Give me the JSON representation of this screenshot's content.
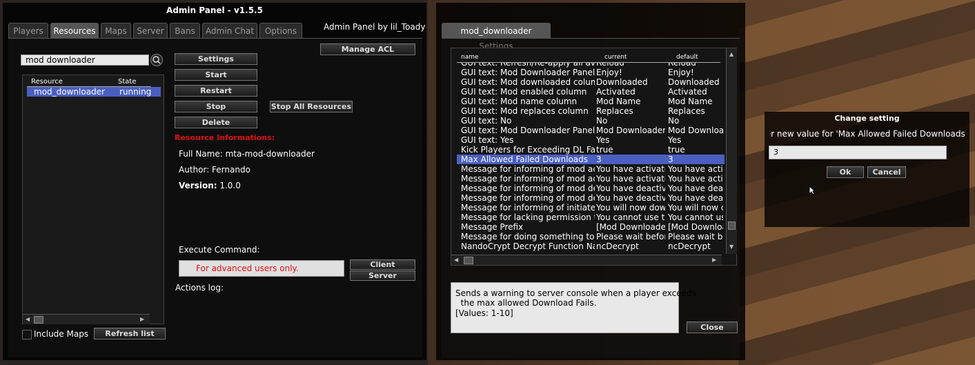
{
  "admin": {
    "title": "Admin Panel  -  v1.5.5",
    "credit": "Admin Panel by lil_Toady",
    "tabs": [
      "Players",
      "Resources",
      "Maps",
      "Server",
      "Bans",
      "Admin Chat",
      "Options"
    ],
    "search_value": "mod  downloader",
    "list_headers": {
      "resource": "Resource",
      "state": "State"
    },
    "list_rows": [
      {
        "resource": "mod_downloader",
        "state": "running"
      }
    ],
    "buttons": {
      "settings": "Settings",
      "start": "Start",
      "restart": "Restart",
      "stop": "Stop",
      "delete": "Delete",
      "manage_acl": "Manage ACL",
      "stop_all": "Stop All Resources",
      "client": "Client",
      "server": "Server",
      "refresh": "Refresh list"
    },
    "include_maps": "Include Maps",
    "info_heading": "Resource Informations:",
    "full_name": "Full Name: mta-mod-downloader",
    "author": "Author: Fernando",
    "version_label": "Version:",
    "version_value": " 1.0.0",
    "execute_label": "Execute Command:",
    "execute_placeholder": "For advanced users only.",
    "actions_log": "Actions log:"
  },
  "settings": {
    "tab": "mod_downloader Settings",
    "headers": {
      "name": "name",
      "current": "current",
      "default": "default"
    },
    "rows": [
      {
        "name": "GUI text: Refresh/Re-apply all availa",
        "current": "Reload",
        "default": "Reload"
      },
      {
        "name": "GUI text: Mod Downloader Panel de",
        "current": "Enjoy!",
        "default": "Enjoy!"
      },
      {
        "name": "GUI text: Mod downloaded column",
        "current": "Downloaded",
        "default": "Downloaded"
      },
      {
        "name": "GUI text: Mod enabled column",
        "current": "Activated",
        "default": "Activated"
      },
      {
        "name": "GUI text: Mod name column",
        "current": "Mod Name",
        "default": "Mod Name"
      },
      {
        "name": "GUI text: Mod replaces column",
        "current": "Replaces",
        "default": "Replaces"
      },
      {
        "name": "GUI text: No",
        "current": "No",
        "default": "No"
      },
      {
        "name": "GUI text: Mod Downloader Panel tit",
        "current": "Mod Downloader",
        "default": "Mod Download"
      },
      {
        "name": "GUI text: Yes",
        "current": "Yes",
        "default": "Yes"
      },
      {
        "name": "Kick Players for Exceeding DL Fails",
        "current": "true",
        "default": "true"
      },
      {
        "name": "Max Allowed Failed Downloads",
        "current": "3",
        "default": "3"
      },
      {
        "name": "Message for informing of mod activ",
        "current": "You have activatec",
        "default": "You have activ"
      },
      {
        "name": "Message for informing of mod activ",
        "current": "You have activatec",
        "default": "You have activ"
      },
      {
        "name": "Message for informing of mod deac",
        "current": "You have deactiva",
        "default": "You have deac"
      },
      {
        "name": "Message for informing of mod deac",
        "current": "You have deactiva",
        "default": "You have deac"
      },
      {
        "name": "Message for informing of initiated m",
        "current": "You will now down",
        "default": "You will now c"
      },
      {
        "name": "Message for lacking permission to o",
        "current": "You cannot use th",
        "default": "You cannot us"
      },
      {
        "name": "Message Prefix",
        "current": "[Mod Downloader]",
        "default": "[Mod Downloa"
      },
      {
        "name": "Message for doing something too fa",
        "current": "Please wait before",
        "default": "Please wait be"
      },
      {
        "name": "NandoCrypt Decrypt Function Name",
        "current": "ncDecrypt",
        "default": "ncDecrypt"
      }
    ],
    "selected_index": 10,
    "description": [
      "Sends a warning to server console when a player exceeds",
      "  the max allowed Download Fails.",
      "[Values: 1-10]"
    ],
    "close": "Close"
  },
  "dialog": {
    "title": "Change setting",
    "prompt": "Enter new value for 'Max Allowed Failed Downloads'",
    "value": "3",
    "ok": "Ok",
    "cancel": "Cancel"
  }
}
